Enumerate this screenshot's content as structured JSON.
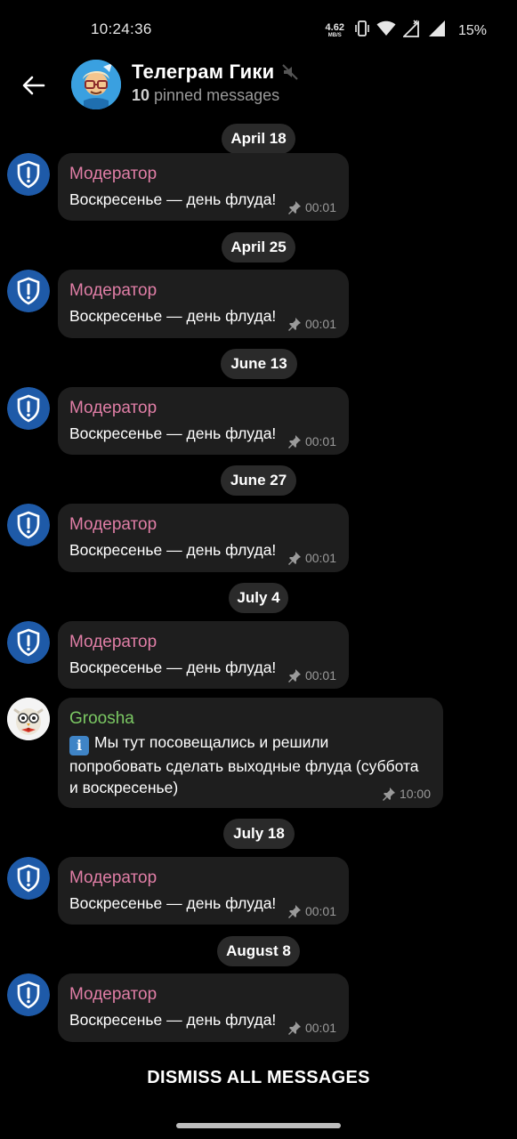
{
  "status_bar": {
    "time": "10:24:36",
    "net_speed_value": "4.62",
    "net_speed_unit": "MB/S",
    "battery": "15%"
  },
  "header": {
    "title": "Телеграм Гики",
    "pinned_count": "10",
    "pinned_label": " pinned messages"
  },
  "dates": [
    "April 18",
    "April 25",
    "June 13",
    "June 27",
    "July 4",
    "July 18",
    "August 8"
  ],
  "messages": [
    {
      "sender": "Модератор",
      "text": "Воскресенье — день флуда!",
      "time": "00:01"
    },
    {
      "sender": "Модератор",
      "text": "Воскресенье — день флуда!",
      "time": "00:01"
    },
    {
      "sender": "Модератор",
      "text": "Воскресенье — день флуда!",
      "time": "00:01"
    },
    {
      "sender": "Модератор",
      "text": "Воскресенье — день флуда!",
      "time": "00:01"
    },
    {
      "sender": "Модератор",
      "text": "Воскресенье — день флуда!",
      "time": "00:01"
    },
    {
      "sender": "Groosha",
      "text_line1": "Мы тут посовещались и решили",
      "text_line2": "попробовать сделать выходные флуда (суббота",
      "text_line3": "и воскресенье)",
      "time": "10:00"
    },
    {
      "sender": "Модератор",
      "text": "Воскресенье — день флуда!",
      "time": "00:01"
    },
    {
      "sender": "Модератор",
      "text": "Воскресенье — день флуда!",
      "time": "00:01"
    }
  ],
  "dismiss_label": "DISMISS ALL MESSAGES",
  "colors": {
    "background": "#000000",
    "bubble": "#1e1e1e",
    "date_pill": "#2a2a2a",
    "moderator_name": "#e07ea6",
    "groosha_name": "#7bc863",
    "shield_avatar": "#1e5aa8"
  }
}
